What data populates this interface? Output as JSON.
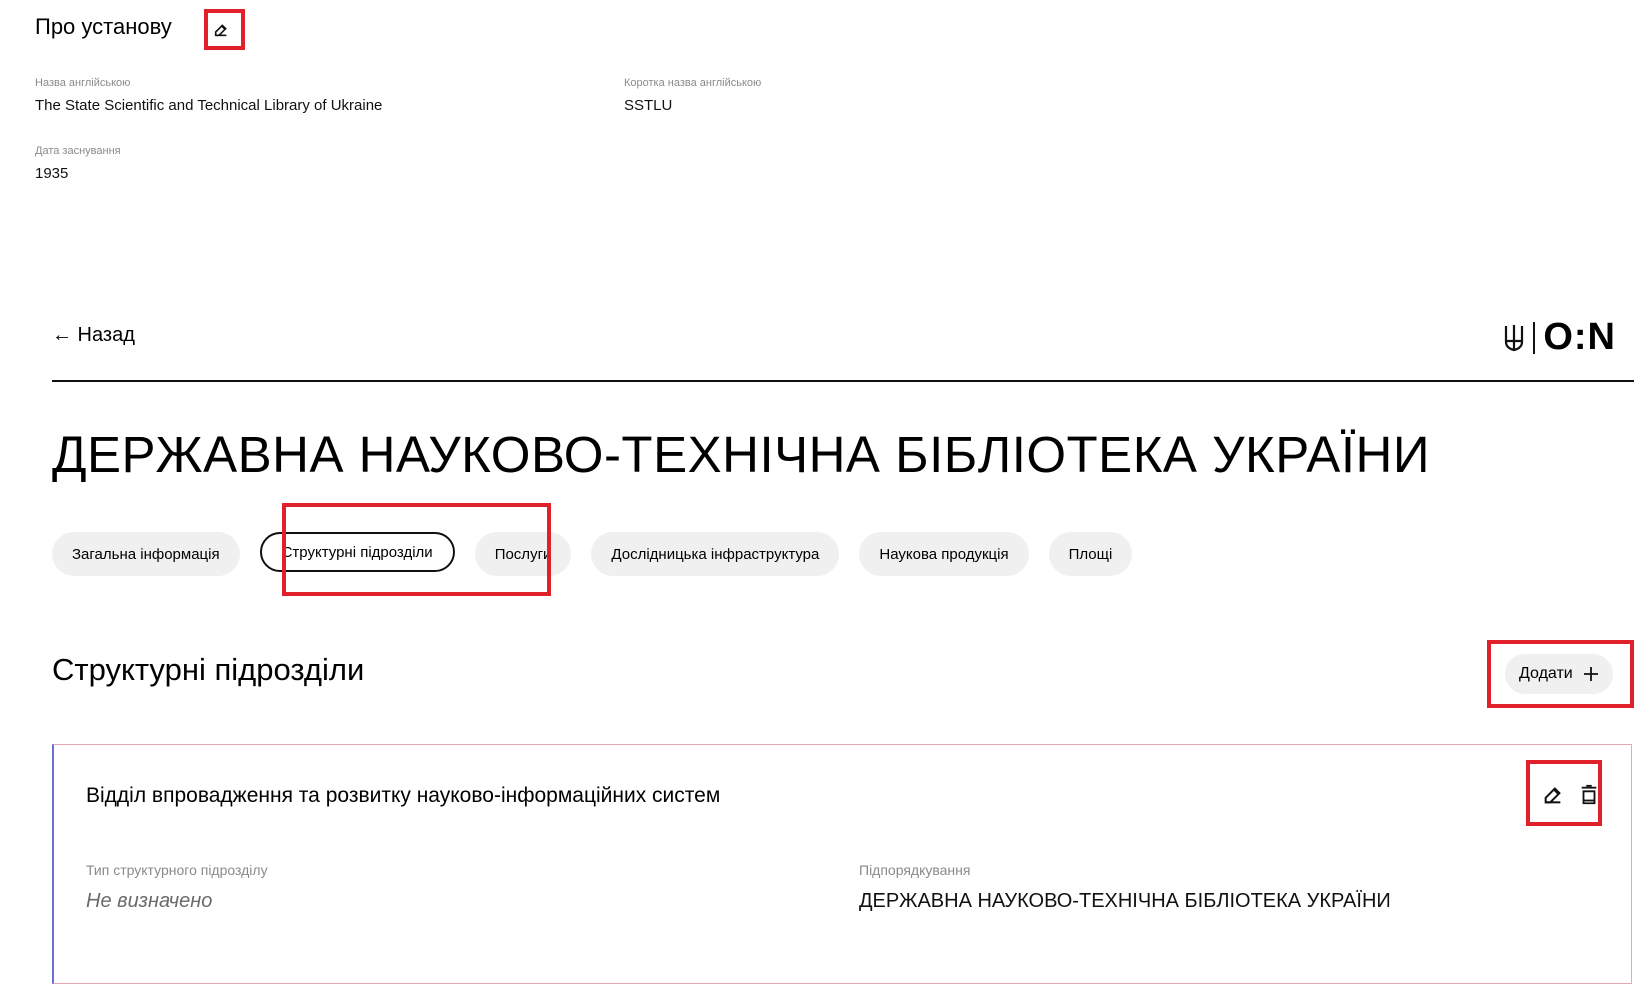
{
  "about": {
    "title": "Про установу",
    "fields": [
      {
        "label": "Назва англійською",
        "value": "The State Scientific and Technical Library of Ukraine"
      },
      {
        "label": "Коротка назва англійською",
        "value": "SSTLU"
      },
      {
        "label": "Дата заснування",
        "value": "1935"
      }
    ]
  },
  "header": {
    "back_label": "← Назад",
    "logo_text": "O:N"
  },
  "page_title": "ДЕРЖАВНА НАУКОВО-ТЕХНІЧНА БІБЛІОТЕКА УКРАЇНИ",
  "tabs": [
    {
      "label": "Загальна інформація"
    },
    {
      "label": "Структурні підрозділи",
      "active": true
    },
    {
      "label": "Послуги"
    },
    {
      "label": "Дослідницька інфраструктура"
    },
    {
      "label": "Наукова продукція"
    },
    {
      "label": "Площі"
    }
  ],
  "section": {
    "title": "Структурні підрозділи",
    "add_label": "Додати"
  },
  "card": {
    "title": "Відділ впровадження та розвитку науково-інформаційних систем",
    "type_label": "Тип структурного підрозділу",
    "type_value": "Не визначено",
    "sub_label": "Підпорядкування",
    "sub_value": "ДЕРЖАВНА НАУКОВО-ТЕХНІЧНА БІБЛІОТЕКА УКРАЇНИ"
  },
  "colors": {
    "highlight": "#e0202a",
    "tab_bg": "#f0f0f0",
    "card_border": "#e6a8b2",
    "card_accent": "#6b6fd8"
  }
}
